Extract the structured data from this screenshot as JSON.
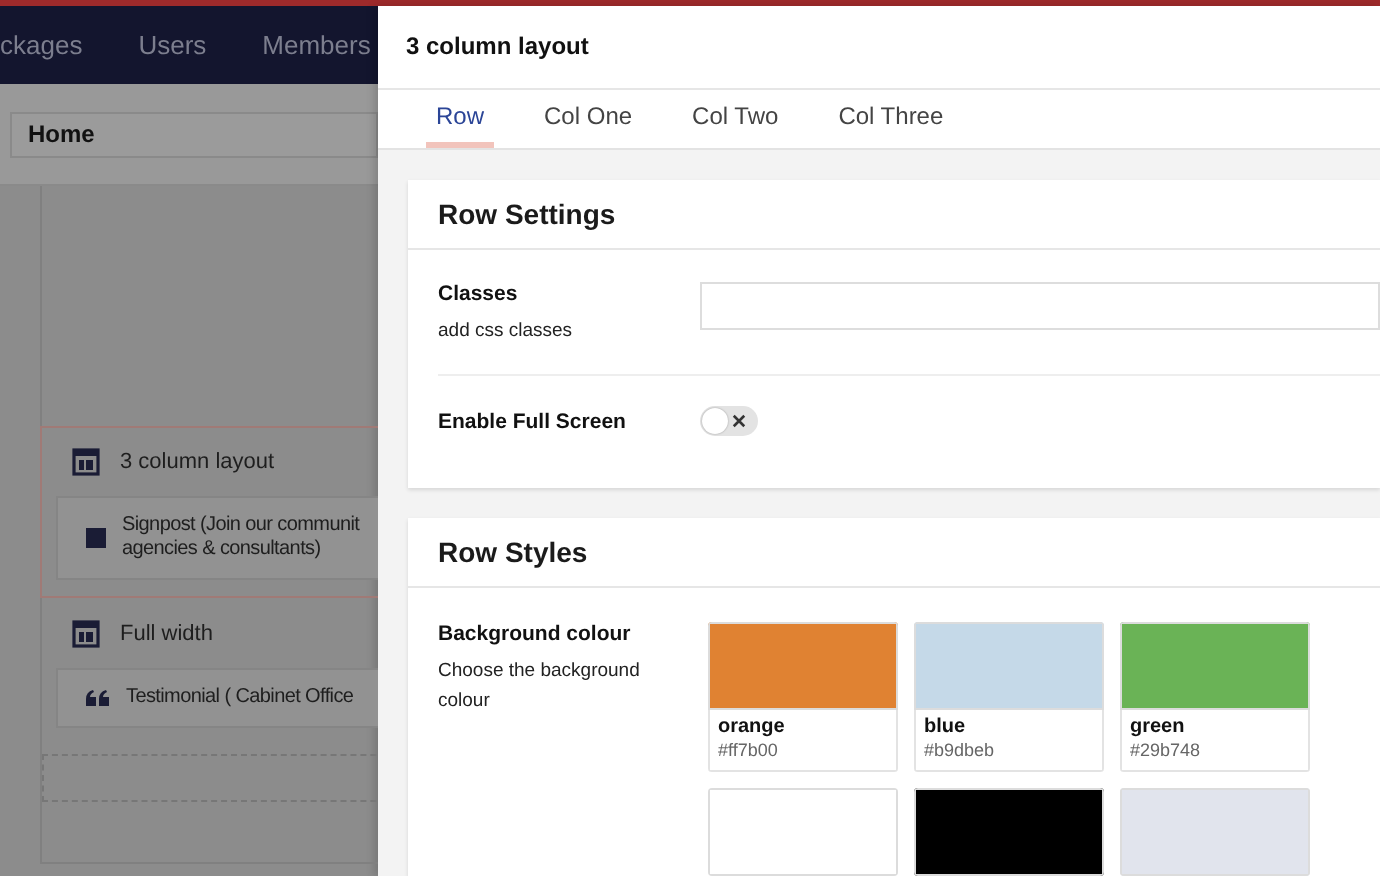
{
  "top_nav": {
    "items": [
      "ckages",
      "Users",
      "Members"
    ]
  },
  "page_field": {
    "value": "Home"
  },
  "editor_blocks": [
    {
      "kind": "layout",
      "label": "3 column layout",
      "selected": true,
      "children": [
        {
          "kind": "square",
          "lines": [
            "Signpost (Join our communit",
            "agencies & consultants)"
          ]
        }
      ]
    },
    {
      "kind": "layout",
      "label": "Full width",
      "selected": false,
      "children": [
        {
          "kind": "quote",
          "lines": [
            "Testimonial ( Cabinet Office"
          ]
        }
      ]
    }
  ],
  "dialog": {
    "title": "3 column layout",
    "tabs": [
      {
        "label": "Row",
        "selected": true
      },
      {
        "label": "Col One",
        "selected": false
      },
      {
        "label": "Col Two",
        "selected": false
      },
      {
        "label": "Col Three",
        "selected": false
      }
    ],
    "row_settings": {
      "title": "Row Settings",
      "fields": [
        {
          "kind": "text",
          "label": "Classes",
          "description": "add css classes"
        },
        {
          "kind": "toggle",
          "label": "Enable Full Screen",
          "on": false
        }
      ]
    },
    "row_styles": {
      "title": "Row Styles",
      "label": "Background colour",
      "description": "Choose the background colour",
      "swatches": [
        {
          "name": "orange",
          "hex": "#ff7b00",
          "color": "#e08232"
        },
        {
          "name": "blue",
          "hex": "#b9dbeb",
          "color": "#c5d9e8"
        },
        {
          "name": "green",
          "hex": "#29b748",
          "color": "#6ab356"
        },
        {
          "color": "#ffffff"
        },
        {
          "color": "#000000"
        },
        {
          "color": "#e1e4ed"
        }
      ]
    }
  }
}
